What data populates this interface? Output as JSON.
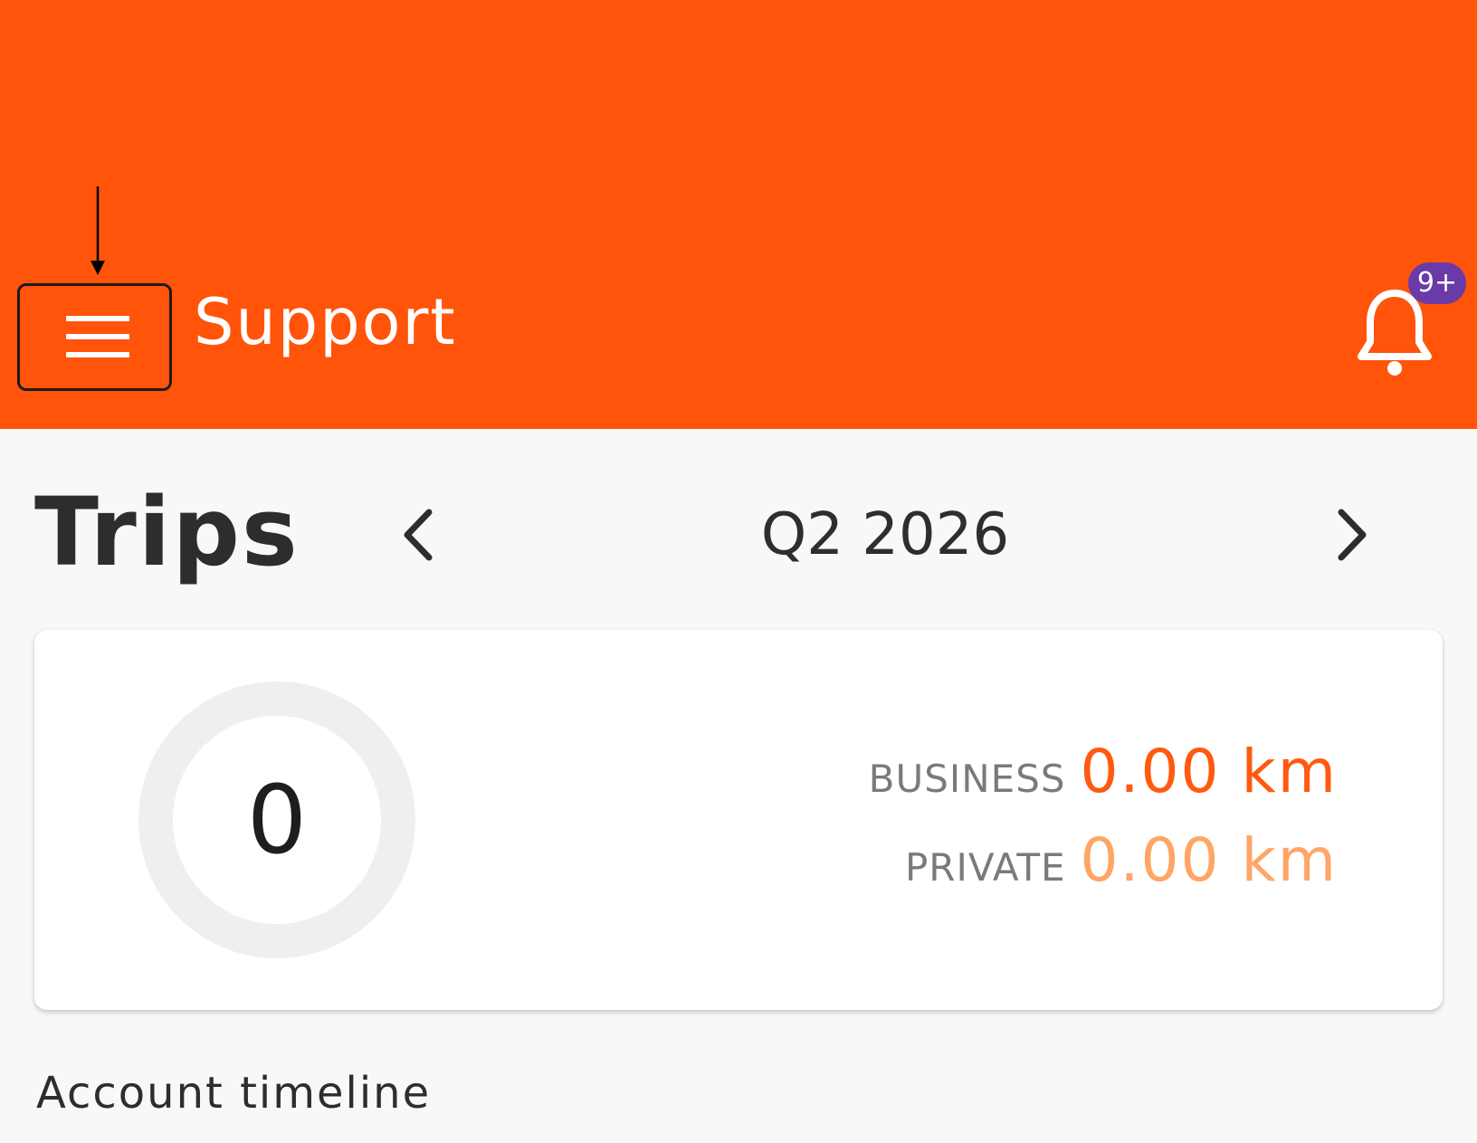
{
  "colors": {
    "header_background": "#ff540a",
    "page_background": "#f8f8f8",
    "business_value": "#ff5a0f",
    "private_value": "#ffa566",
    "badge_background": "#6a3aa8"
  },
  "header": {
    "menu_icon": "hamburger-menu-icon",
    "title": "Support",
    "notification_icon": "bell-icon",
    "notification_badge": "9+"
  },
  "trips": {
    "title": "Trips",
    "prev_icon": "chevron-left-icon",
    "period": "Q2 2026",
    "next_icon": "chevron-right-icon",
    "trip_count": "0",
    "business_label": "BUSINESS",
    "business_value": "0.00 km",
    "private_label": "PRIVATE",
    "private_value": "0.00 km"
  },
  "section": {
    "heading": "Account timeline"
  }
}
